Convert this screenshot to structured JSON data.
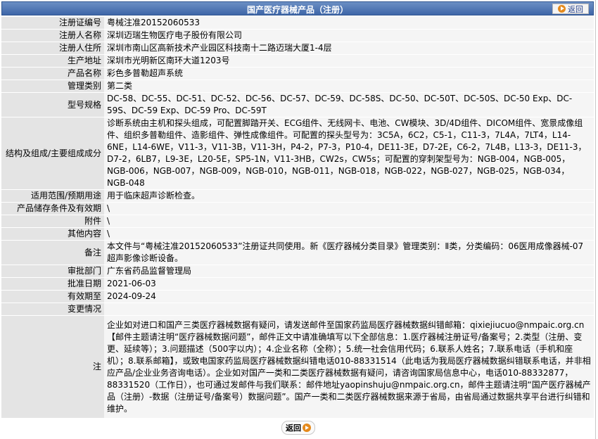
{
  "header": {
    "title": "国产医疗器械产品（注册）",
    "back_label": "返回"
  },
  "rows": [
    {
      "label": "注册证编号",
      "value": "粤械注准20152060533"
    },
    {
      "label": "注册人名称",
      "value": "深圳迈瑞生物医疗电子股份有限公司"
    },
    {
      "label": "注册人住所",
      "value": "深圳市南山区高新技术产业园区科技南十二路迈瑞大厦1-4层"
    },
    {
      "label": "生产地址",
      "value": "深圳市光明新区南环大道1203号"
    },
    {
      "label": "产品名称",
      "value": "彩色多普勒超声系统"
    },
    {
      "label": "管理类别",
      "value": "第二类"
    },
    {
      "label": "型号规格",
      "value": "DC-58、DC-55、DC-51、DC-52、DC-56、DC-57、DC-59、DC-58S、DC-50、DC-50T、DC-50S、DC-50 Exp、DC-59S、DC-59 Exp、DC-59 Pro、DC-59T"
    },
    {
      "label": "结构及组成/主要组成成分",
      "value": "诊断系统由主机和探头组成，可配置脚踏开关、ECG组件、无线网卡、电池、CW模块、3D/4D组件、DICOM组件、宽景成像组件、组织多普勒组件、造影组件、弹性成像组件。可配置的探头型号为：3C5A，6C2，C5-1，C11-3，7L4A，7LT4，L14-6NE，L14-6WE，V11-3，V11-3B，V11-3H，P4-2，P7-3，P10-4，DE11-3E，D7-2E，C6-2，7L4B，L13-3，DE11-3，D7-2，6LB7，L9-3E，L20-5E，SP5-1N，V11-3HB，CW2s，CW5s；可配置的穿刺架型号为：NGB-004，NGB-005，NGB-006，NGB-007，NGB-009，NGB-010，NGB-011，NGB-018，NGB-022，NGB-027，NGB-025，NGB-034，NGB-048"
    },
    {
      "label": "适用范围/预期用途",
      "value": "用于临床超声诊断检查。"
    },
    {
      "label": "产品储存条件及有效期",
      "value": "\\"
    },
    {
      "label": "附件",
      "value": "\\"
    },
    {
      "label": "其他内容",
      "value": "\\"
    },
    {
      "label": "备注",
      "value": "本文件与“粤械注准20152060533”注册证共同使用。新《医疗器械分类目录》管理类别：Ⅱ类，分类编码：06医用成像器械-07超声影像诊断设备。"
    },
    {
      "label": "审批部门",
      "value": "广东省药品监督管理局"
    },
    {
      "label": "批准日期",
      "value": "2021-06-03"
    },
    {
      "label": "有效期至",
      "value": "2024-09-24"
    },
    {
      "label": "变更情况",
      "value": ""
    },
    {
      "label": "注",
      "value": "企业如对进口和国产三类医疗器械数据有疑问，请发送邮件至国家药监局医疗器械数据纠错邮箱：qixiejiucuo@nmpaic.org.cn【邮件主题请注明“医疗器械数据问题”，邮件正文中请准确填写以下全部信息：1.医疗器械注册证号/备案号；2.类型（注册、变更、延续等）；3.问题描述（500字以内）；4.企业名称（全称）；5.统一社会信用代码；6.联系人姓名；7.联系电话（手机和座机）；8.联系邮箱】，或致电国家药监局医疗器械数据纠错电话010-88331514（此电话为我局医疗器械数据纠错联系电话，并非相应产品/企业业务咨询电话）。企业如对国产一类和二类医疗器械数据有疑问，请咨询国家局信息中心，电话010-88332877，88331520（工作日），也可通过发邮件与我们联系：邮件地址yaopinshuju@nmpaic.org.cn，邮件主题请注明“国产医疗器械产品（注册）-数据（注册证号/备案号）数据问题”。国产一类和二类医疗器械数据来源于省局，由省局通过数据共享平台进行纠错和维护。"
    }
  ],
  "footer": {
    "back_label": "返回"
  }
}
